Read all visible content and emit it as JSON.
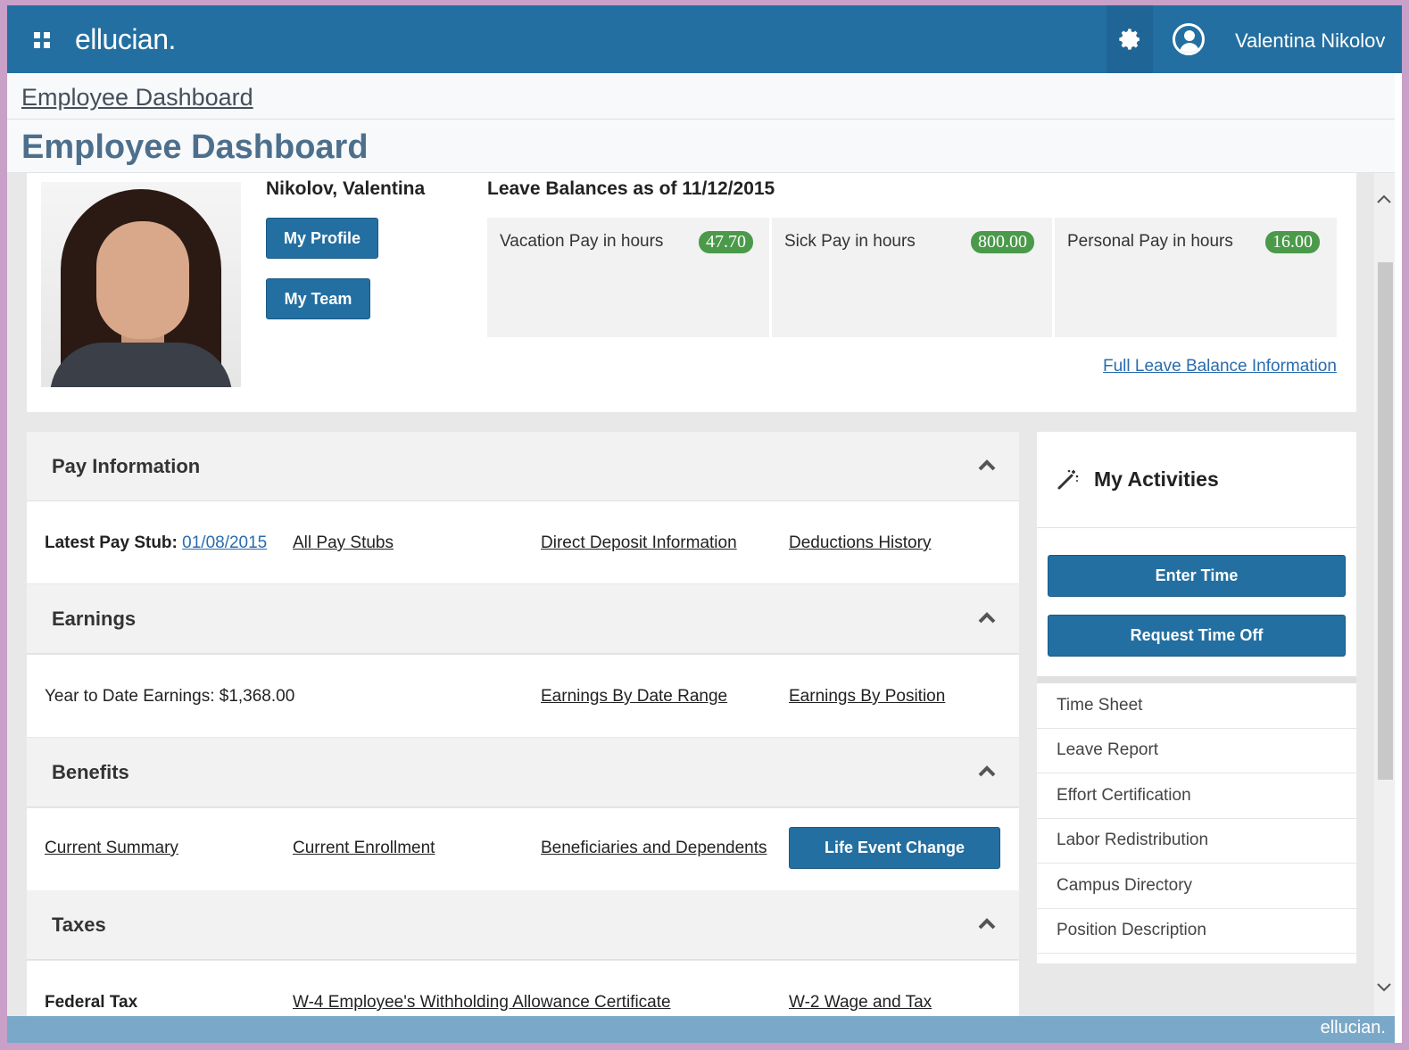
{
  "topbar": {
    "logo": "ellucian.",
    "user_name": "Valentina Nikolov"
  },
  "breadcrumb": "Employee Dashboard",
  "page_title": "Employee Dashboard",
  "profile": {
    "name": "Nikolov, Valentina",
    "my_profile": "My Profile",
    "my_team": "My Team"
  },
  "leave": {
    "title": "Leave Balances as of 11/12/2015",
    "items": [
      {
        "label": "Vacation Pay in hours",
        "value": "47.70"
      },
      {
        "label": "Sick Pay in hours",
        "value": "800.00"
      },
      {
        "label": "Personal Pay in hours",
        "value": "16.00"
      }
    ],
    "full_link": "Full Leave Balance Information"
  },
  "pay_info": {
    "title": "Pay Information",
    "latest_label": "Latest Pay Stub:",
    "latest_date": "01/08/2015",
    "all_stubs": "All Pay Stubs",
    "direct_deposit": "Direct Deposit Information",
    "deductions": "Deductions History"
  },
  "earnings": {
    "title": "Earnings",
    "ytd": "Year to Date Earnings: $1,368.00",
    "by_date": "Earnings By Date Range",
    "by_position": "Earnings By Position"
  },
  "benefits": {
    "title": "Benefits",
    "current_summary": "Current Summary",
    "current_enrollment": "Current Enrollment",
    "beneficiaries": "Beneficiaries and Dependents",
    "life_event": "Life Event Change"
  },
  "taxes": {
    "title": "Taxes",
    "federal": "Federal Tax",
    "w4": "W-4 Employee's Withholding Allowance Certificate",
    "w2": "W-2 Wage and Tax"
  },
  "activities": {
    "title": "My Activities",
    "enter_time": "Enter Time",
    "request_time_off": "Request Time Off",
    "items": [
      "Time Sheet",
      "Leave Report",
      "Effort Certification",
      "Labor Redistribution",
      "Campus Directory",
      "Position Description"
    ]
  },
  "footer_logo": "ellucian.",
  "colors": {
    "brand_blue": "#236fa1",
    "badge_green": "#4a9a4a",
    "link_blue": "#2a6cae",
    "title_slate": "#4d6f8c"
  }
}
